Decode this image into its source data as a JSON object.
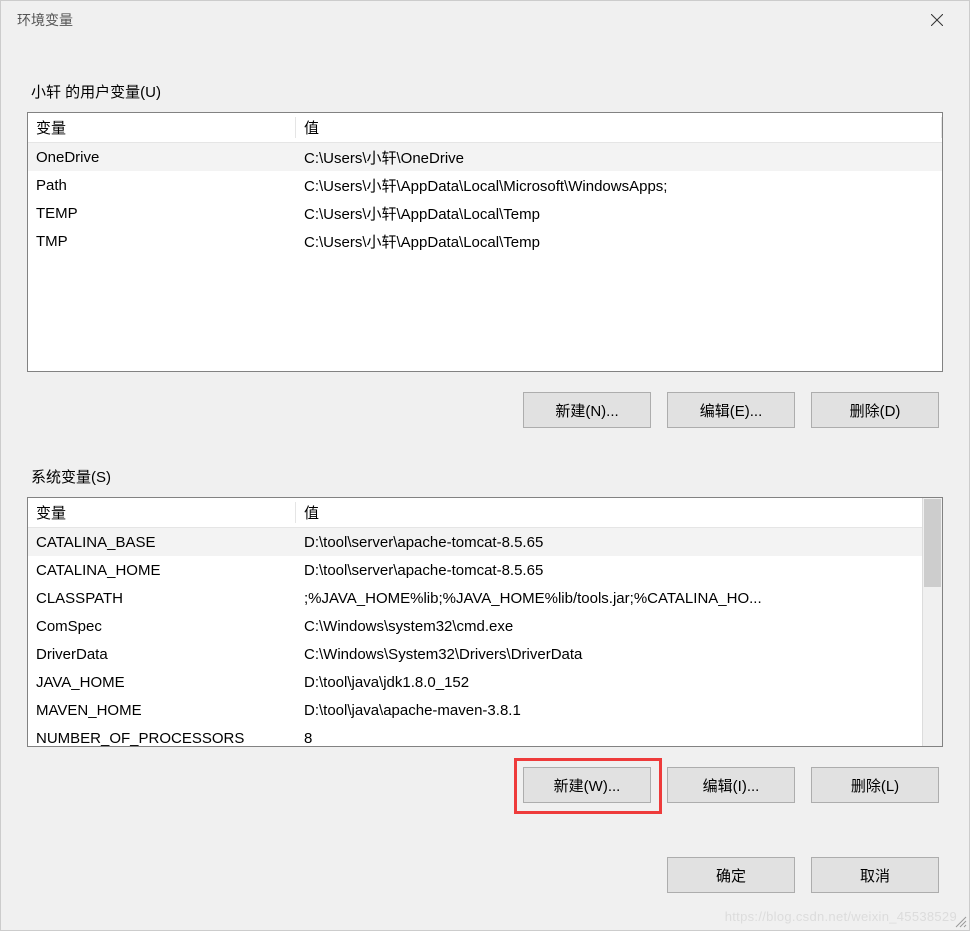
{
  "window": {
    "title": "环境变量"
  },
  "user_section": {
    "label": "小轩 的用户变量(U)",
    "columns": {
      "name": "变量",
      "value": "值"
    },
    "rows": [
      {
        "name": "OneDrive",
        "value": "C:\\Users\\小轩\\OneDrive",
        "selected": true
      },
      {
        "name": "Path",
        "value": "C:\\Users\\小轩\\AppData\\Local\\Microsoft\\WindowsApps;",
        "selected": false
      },
      {
        "name": "TEMP",
        "value": "C:\\Users\\小轩\\AppData\\Local\\Temp",
        "selected": false
      },
      {
        "name": "TMP",
        "value": "C:\\Users\\小轩\\AppData\\Local\\Temp",
        "selected": false
      }
    ],
    "buttons": {
      "new": "新建(N)...",
      "edit": "编辑(E)...",
      "delete": "删除(D)"
    }
  },
  "system_section": {
    "label": "系统变量(S)",
    "columns": {
      "name": "变量",
      "value": "值"
    },
    "rows": [
      {
        "name": "CATALINA_BASE",
        "value": "D:\\tool\\server\\apache-tomcat-8.5.65",
        "selected": true
      },
      {
        "name": "CATALINA_HOME",
        "value": "D:\\tool\\server\\apache-tomcat-8.5.65",
        "selected": false
      },
      {
        "name": "CLASSPATH",
        "value": ";%JAVA_HOME%lib;%JAVA_HOME%lib/tools.jar;%CATALINA_HO...",
        "selected": false
      },
      {
        "name": "ComSpec",
        "value": "C:\\Windows\\system32\\cmd.exe",
        "selected": false
      },
      {
        "name": "DriverData",
        "value": "C:\\Windows\\System32\\Drivers\\DriverData",
        "selected": false
      },
      {
        "name": "JAVA_HOME",
        "value": "D:\\tool\\java\\jdk1.8.0_152",
        "selected": false
      },
      {
        "name": "MAVEN_HOME",
        "value": "D:\\tool\\java\\apache-maven-3.8.1",
        "selected": false
      },
      {
        "name": "NUMBER_OF_PROCESSORS",
        "value": "8",
        "selected": false
      }
    ],
    "buttons": {
      "new": "新建(W)...",
      "edit": "编辑(I)...",
      "delete": "删除(L)"
    }
  },
  "dialog_buttons": {
    "ok": "确定",
    "cancel": "取消"
  },
  "watermark": "https://blog.csdn.net/weixin_45538529"
}
